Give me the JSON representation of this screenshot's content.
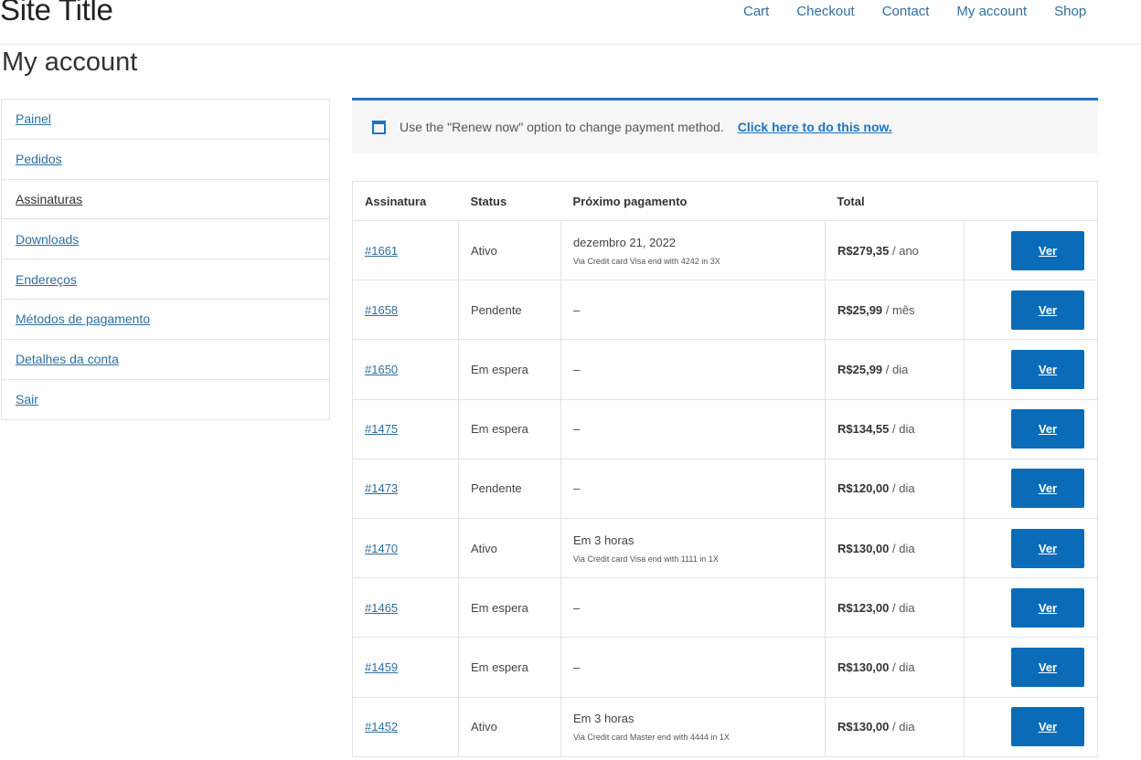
{
  "header": {
    "site_title": "Site Title",
    "nav": [
      "Cart",
      "Checkout",
      "Contact",
      "My account",
      "Shop"
    ]
  },
  "page_title": "My account",
  "account_nav": [
    {
      "label": "Painel",
      "active": false
    },
    {
      "label": "Pedidos",
      "active": false
    },
    {
      "label": "Assinaturas",
      "active": true
    },
    {
      "label": "Downloads",
      "active": false
    },
    {
      "label": "Endereços",
      "active": false
    },
    {
      "label": "Métodos de pagamento",
      "active": false
    },
    {
      "label": "Detalhes da conta",
      "active": false
    },
    {
      "label": "Sair",
      "active": false
    }
  ],
  "notice": {
    "message": "Use the \"Renew now\" option to change payment method.",
    "link": "Click here to do this now."
  },
  "table": {
    "headers": [
      "Assinatura",
      "Status",
      "Próximo pagamento",
      "Total",
      ""
    ],
    "button_label": "Ver",
    "rows": [
      {
        "id": "#1661",
        "status": "Ativo",
        "next": "dezembro 21, 2022",
        "via": "Via Credit card Visa end with 4242 in 3X",
        "price": "R$279,35",
        "period": " / ano"
      },
      {
        "id": "#1658",
        "status": "Pendente",
        "next": "–",
        "via": "",
        "price": "R$25,99",
        "period": " / mês"
      },
      {
        "id": "#1650",
        "status": "Em espera",
        "next": "–",
        "via": "",
        "price": "R$25,99",
        "period": " / dia"
      },
      {
        "id": "#1475",
        "status": "Em espera",
        "next": "–",
        "via": "",
        "price": "R$134,55",
        "period": " / dia"
      },
      {
        "id": "#1473",
        "status": "Pendente",
        "next": "–",
        "via": "",
        "price": "R$120,00",
        "period": " / dia"
      },
      {
        "id": "#1470",
        "status": "Ativo",
        "next": "Em 3 horas",
        "via": "Via Credit card Visa end with 1111 in 1X",
        "price": "R$130,00",
        "period": " / dia"
      },
      {
        "id": "#1465",
        "status": "Em espera",
        "next": "–",
        "via": "",
        "price": "R$123,00",
        "period": " / dia"
      },
      {
        "id": "#1459",
        "status": "Em espera",
        "next": "–",
        "via": "",
        "price": "R$130,00",
        "period": " / dia"
      },
      {
        "id": "#1452",
        "status": "Ativo",
        "next": "Em 3 horas",
        "via": "Via Credit card Master end with 4444 in 1X",
        "price": "R$130,00",
        "period": " / dia"
      }
    ]
  },
  "colors": {
    "accent": "#1e73be",
    "button": "#0a6cb8",
    "link": "#2f6f9f"
  }
}
